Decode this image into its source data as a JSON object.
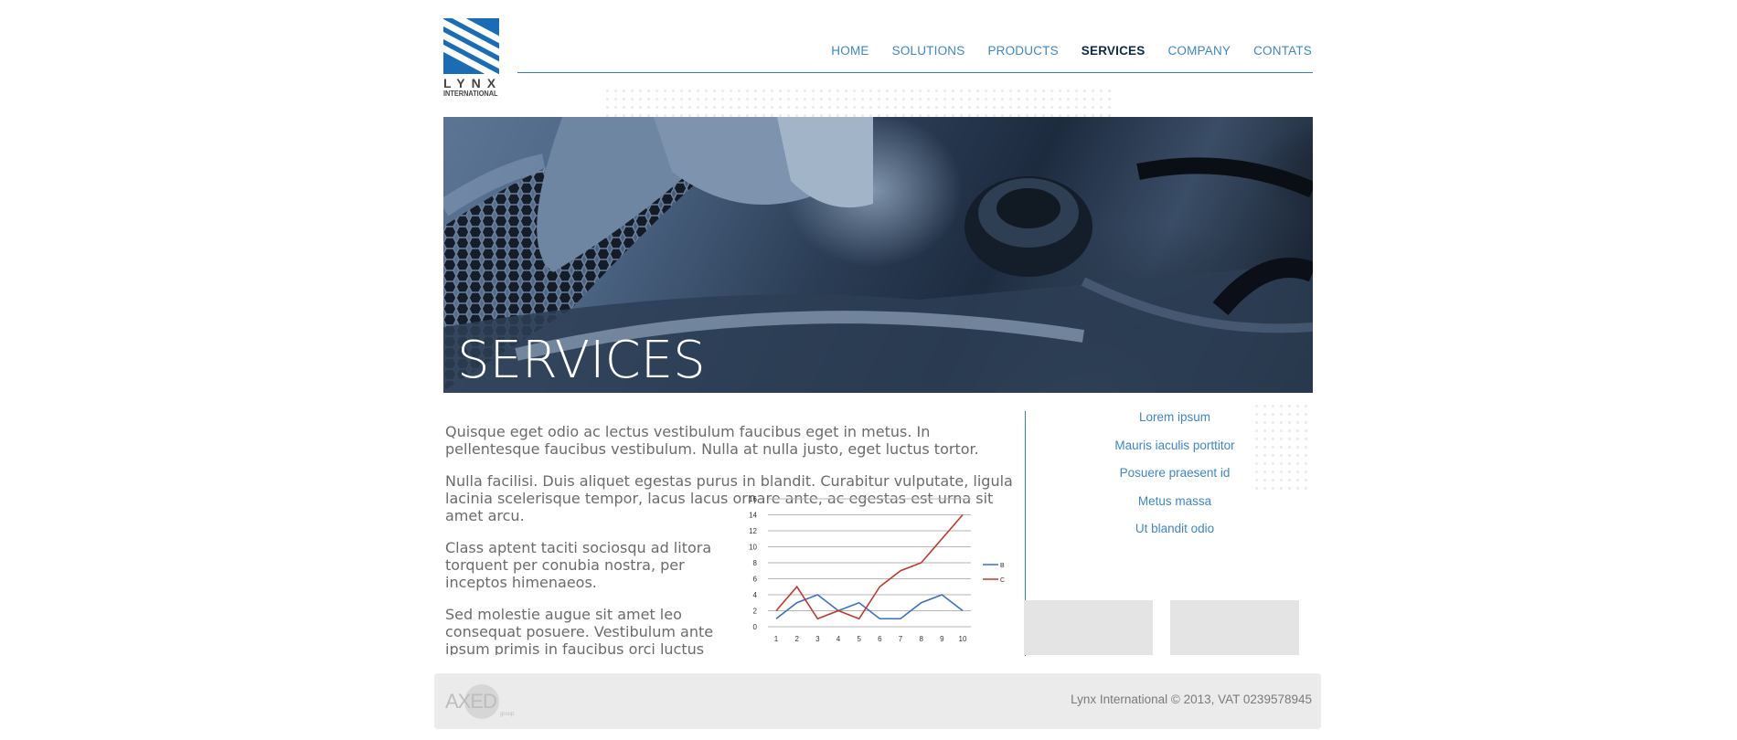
{
  "brand": {
    "name": "LYNX",
    "sub": "INTERNATIONAL",
    "partner_logo": "AXED"
  },
  "nav": [
    {
      "label": "HOME",
      "active": false
    },
    {
      "label": "SOLUTIONS",
      "active": false
    },
    {
      "label": "PRODUCTS",
      "active": false
    },
    {
      "label": "SERVICES",
      "active": true
    },
    {
      "label": "COMPANY",
      "active": false
    },
    {
      "label": "CONTATS",
      "active": false
    }
  ],
  "hero": {
    "title": "SERVICES",
    "image": "car-engine-photo"
  },
  "content": {
    "p1": "Quisque eget odio ac lectus vestibulum faucibus eget in metus. In pellentesque faucibus vestibulum. Nulla at nulla justo, eget luctus tortor.",
    "p2": "Nulla facilisi. Duis aliquet egestas purus in blandit. Curabitur vulputate, ligula lacinia scelerisque tempor, lacus lacus ornare ante, ac egestas est urna sit amet arcu.",
    "p3": "Class aptent taciti sociosqu ad litora torquent per conubia nostra, per inceptos himenaeos.",
    "p4": "Sed molestie augue sit amet leo consequat posuere. Vestibulum ante ipsum primis in faucibus orci luctus et ultrices posuere cubilia Curae; Proin vel ante a orci tempus eleifend ut et magna. Lorem ipsum dolor sit amet, consectetur adipiscing elit. Vivamus luctus"
  },
  "sidebar": {
    "links": [
      "Lorem ipsum",
      "Mauris iaculis porttitor",
      "Posuere praesent id",
      "Metus massa",
      "Ut blandit odio"
    ]
  },
  "footer": {
    "copyright": "Lynx International © 2013, VAT 0239578945"
  },
  "colors": {
    "accent": "#2f7db9",
    "link": "#3f86c5",
    "active_nav": "#0e2a47",
    "series_b": "#3a6fc4",
    "series_c": "#c0392b"
  },
  "chart_data": {
    "type": "line",
    "x": [
      1,
      2,
      3,
      4,
      5,
      6,
      7,
      8,
      9,
      10
    ],
    "ylim": [
      0,
      16
    ],
    "yticks": [
      0,
      2,
      4,
      6,
      8,
      10,
      12,
      14,
      16
    ],
    "grid": true,
    "legend": "right",
    "series": [
      {
        "name": "B",
        "color": "#3a6fc4",
        "values": [
          1,
          3,
          4,
          2,
          3,
          1,
          1,
          3,
          4,
          2
        ]
      },
      {
        "name": "C",
        "color": "#c0392b",
        "values": [
          2,
          5,
          1,
          2,
          1,
          5,
          7,
          8,
          11,
          14
        ]
      }
    ]
  }
}
